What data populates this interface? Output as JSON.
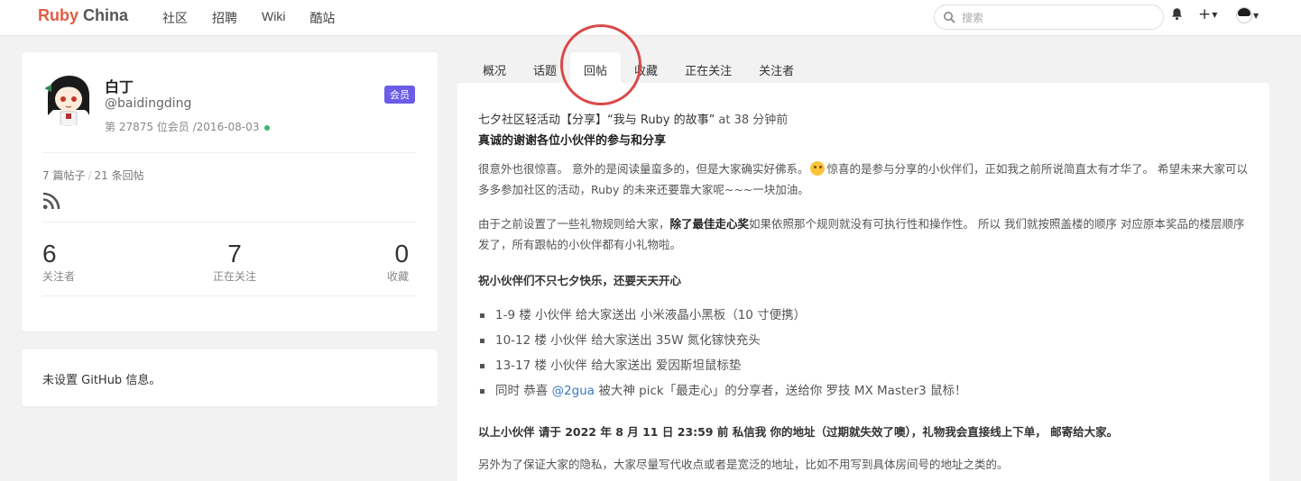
{
  "navbar": {
    "brand_part1": "Ruby",
    "brand_part2": "China",
    "links": [
      "社区",
      "招聘",
      "Wiki",
      "酷站"
    ],
    "search_placeholder": "搜索",
    "plus_label": "+"
  },
  "profile": {
    "name": "白丁",
    "login": "@baidingding",
    "member_info": "第 27875 位会员 /2016-08-03",
    "badge": "会员",
    "topics_count": "7 篇帖子",
    "replies_count": "21 条回帖",
    "separator": "/",
    "stats": [
      {
        "num": "6",
        "label": "关注者"
      },
      {
        "num": "7",
        "label": "正在关注"
      },
      {
        "num": "0",
        "label": "收藏"
      }
    ]
  },
  "github": {
    "text": "未设置 GitHub 信息。"
  },
  "tabs": [
    {
      "label": "概况",
      "active": false
    },
    {
      "label": "话题",
      "active": false
    },
    {
      "label": "回帖",
      "active": true
    },
    {
      "label": "收藏",
      "active": false
    },
    {
      "label": "正在关注",
      "active": false
    },
    {
      "label": "关注者",
      "active": false
    }
  ],
  "reply": {
    "topic_title": "七夕社区轻活动【分享】“我与 Ruby 的故事”",
    "time": "at 38 分钟前",
    "subtitle": "真诚的谢谢各位小伙伴的参与和分享",
    "para1_a": "很意外也很惊喜。 意外的是阅读量蛮多的，但是大家确实好佛系。",
    "para1_b": "惊喜的是参与分享的小伙伴们，正如我之前所说简直太有才华了。 希望未来大家可以多多参加社区的活动，Ruby 的未来还要靠大家呢~~~一块加油。",
    "para2_a": "由于之前设置了一些礼物规则给大家，",
    "para2_bold": "除了最佳走心奖",
    "para2_b": "如果依照那个规则就没有可执行性和操作性。 所以 我们就按照盖楼的顺序 对应原本奖品的楼层顺序发了，所有跟帖的小伙伴都有小礼物啦。",
    "wish": "祝小伙伴们不只七夕快乐，还要天天开心",
    "list": [
      "1-9 楼 小伙伴 给大家送出 小米液晶小黑板（10 寸便携）",
      "10-12 楼 小伙伴 给大家送出 35W 氮化镓快充头",
      "13-17 楼 小伙伴 给大家送出 爱因斯坦鼠标垫"
    ],
    "list_last_a": "同时 恭喜",
    "mention": "@2gua",
    "list_last_b": "被大神 pick「最走心」的分享者，送给你 罗技 MX Master3 鼠标！",
    "deadline": "以上小伙伴 请于 2022 年 8 月 11 日 23:59 前 私信我 你的地址（过期就失效了噢），礼物我会直接线上下单， 邮寄给大家。",
    "privacy": "另外为了保证大家的隐私，大家尽量写代收点或者是宽泛的地址，比如不用写到具体房间号的地址之类的。"
  },
  "colors": {
    "brand_red": "#e05d44",
    "badge_purple": "#6c5ce7",
    "annotation_red": "#d94a4a",
    "online_green": "#3cb371",
    "mention_blue": "#3a78c2"
  }
}
